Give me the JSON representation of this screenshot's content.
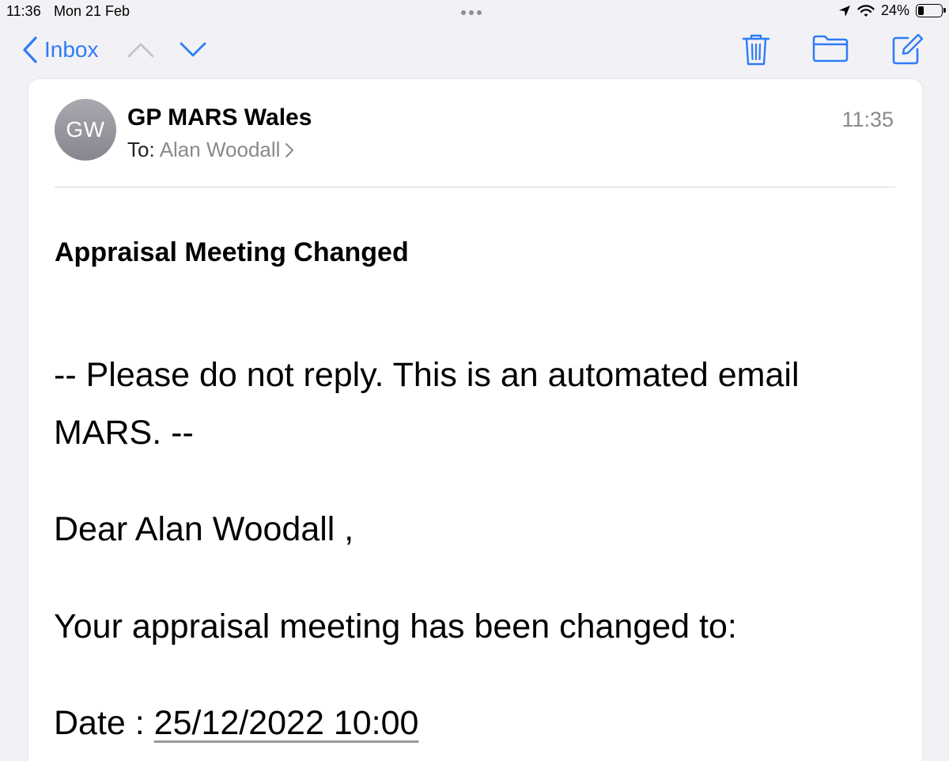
{
  "status_bar": {
    "time": "11:36",
    "date": "Mon 21 Feb",
    "battery_percent": "24%",
    "battery_level": 0.24
  },
  "toolbar": {
    "back_label": "Inbox",
    "icons": [
      "chevron-left-icon",
      "chevron-up-icon",
      "chevron-down-icon",
      "trash-icon",
      "folder-icon",
      "compose-icon"
    ]
  },
  "message": {
    "avatar_initials": "GW",
    "sender": "GP MARS Wales",
    "to_prefix": "To:",
    "recipient": "Alan Woodall",
    "time": "11:35",
    "subject": "Appraisal Meeting Changed",
    "body": {
      "notice": " --  Please do not reply. This is an automated email",
      "notice_cont": "MARS.  --",
      "greeting": "Dear Alan Woodall ,",
      "changed": "Your appraisal meeting has been changed to:",
      "date_label": "Date : ",
      "date_value": "25/12/2022 10:00"
    }
  },
  "colors": {
    "accent": "#2f7cf6",
    "secondary_text": "#8a8a8e",
    "background": "#f2f2f6"
  }
}
